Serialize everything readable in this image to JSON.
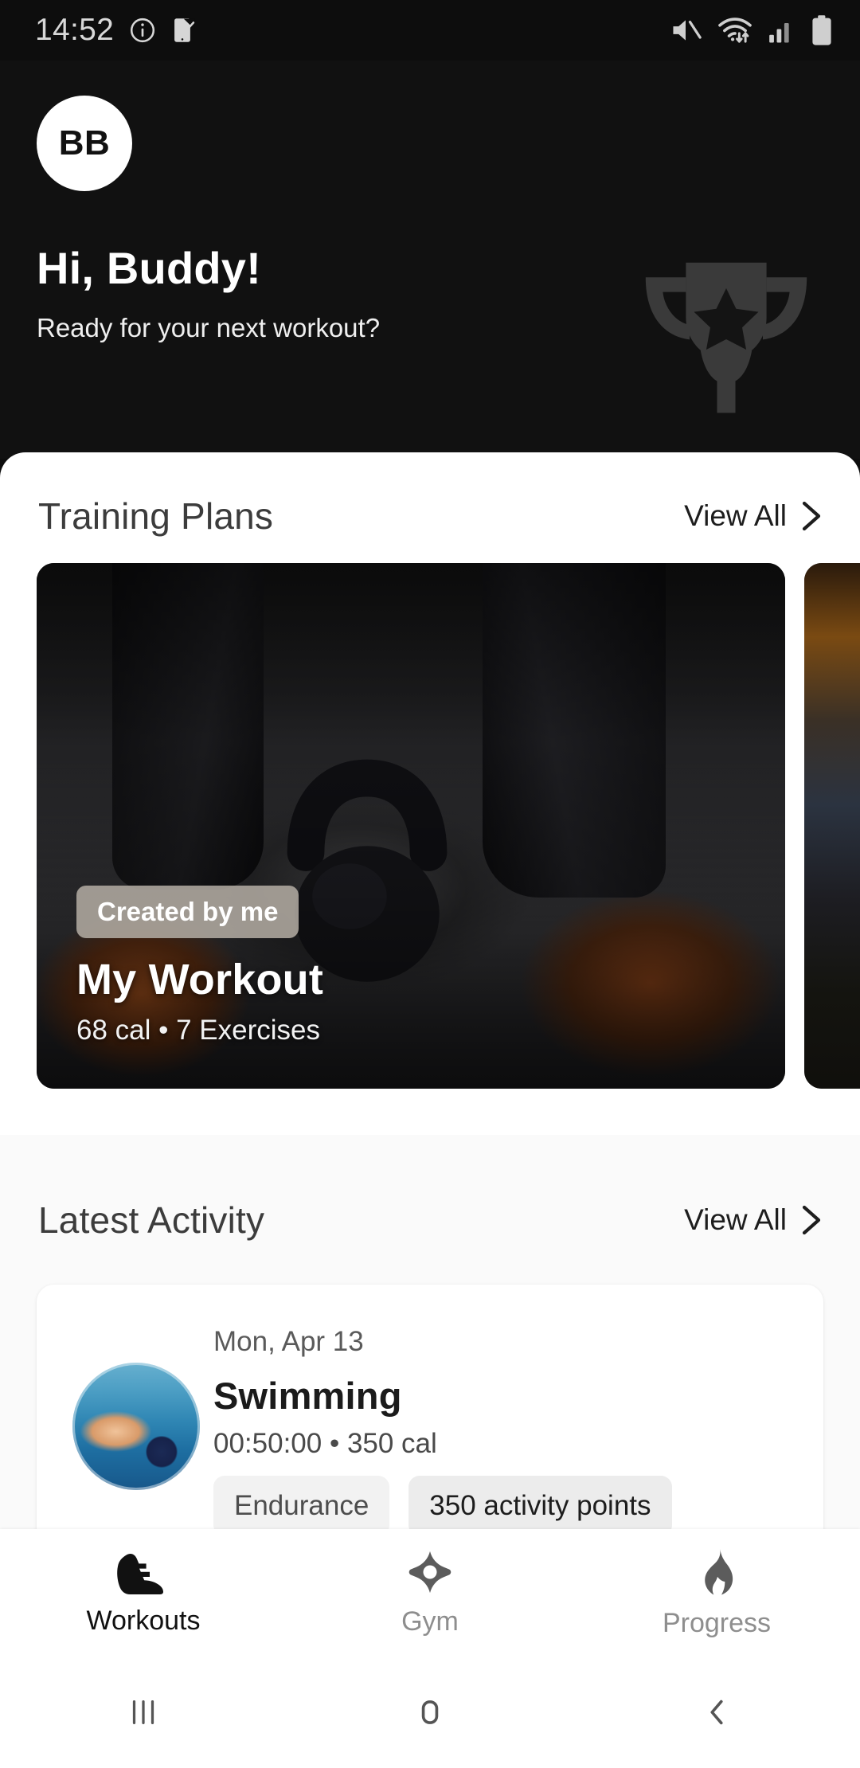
{
  "status_bar": {
    "time": "14:52",
    "icons_left": [
      "info-circle-icon",
      "phone-check-icon"
    ],
    "icons_right": [
      "mute-icon",
      "wifi-icon",
      "signal-icon",
      "battery-icon"
    ]
  },
  "header": {
    "avatar_initials": "BB",
    "greeting": "Hi, Buddy!",
    "subtitle": "Ready for your next workout?",
    "watermark_icon": "trophy-icon",
    "background_color": "#111111"
  },
  "training_plans": {
    "title": "Training Plans",
    "view_all": "View All",
    "cards": [
      {
        "badge": "Created by me",
        "title": "My Workout",
        "meta": "68 cal • 7 Exercises",
        "image": "kettlebell-photo"
      },
      {
        "image": "gym-photo-peek"
      }
    ]
  },
  "latest_activity": {
    "title": "Latest Activity",
    "view_all": "View All",
    "items": [
      {
        "date": "Mon, Apr 13",
        "name": "Swimming",
        "meta": "00:50:00 • 350 cal",
        "thumbnail": "swimming-photo",
        "chips": [
          "Endurance",
          "350 activity points"
        ]
      }
    ]
  },
  "bottom_nav": {
    "items": [
      {
        "label": "Workouts",
        "icon": "shoe-icon",
        "active": true
      },
      {
        "label": "Gym",
        "icon": "gym-diamond-icon",
        "active": false
      },
      {
        "label": "Progress",
        "icon": "flame-icon",
        "active": false
      }
    ],
    "active_color": "#111111",
    "inactive_color": "#8e8e8e"
  },
  "android_nav": {
    "recents": "recents-icon",
    "home": "home-icon",
    "back": "back-icon"
  }
}
